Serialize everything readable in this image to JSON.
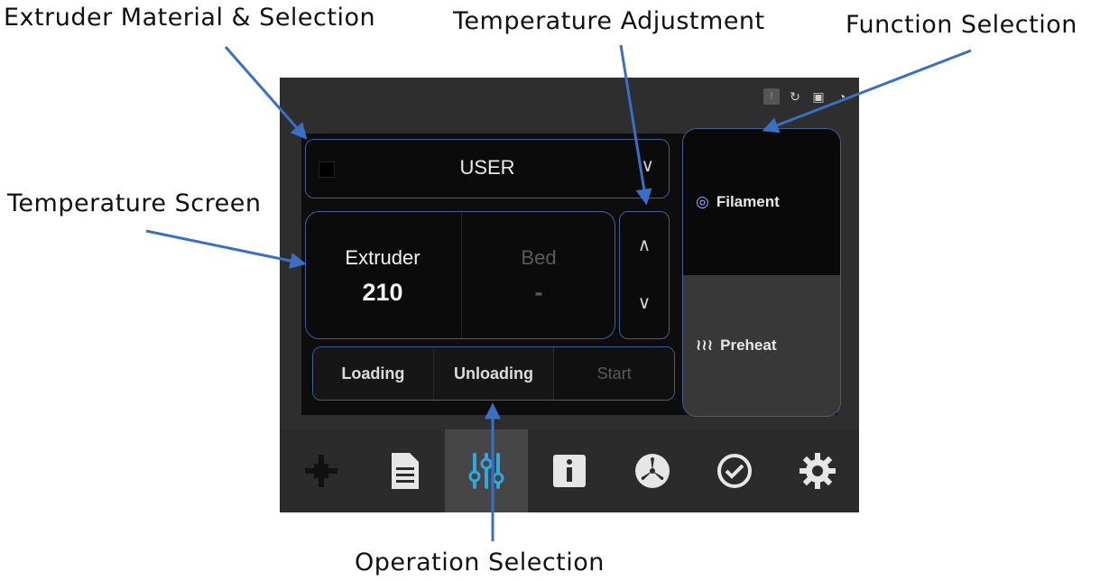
{
  "annotations": {
    "material": "Extruder Material & Selection",
    "temp_adjust": "Temperature Adjustment",
    "function": "Function Selection",
    "temp_screen": "Temperature Screen",
    "operation": "Operation Selection"
  },
  "material_select": {
    "value": "USER",
    "chevron": "∨"
  },
  "temperature": {
    "extruder_label": "Extruder",
    "extruder_value": "210",
    "bed_label": "Bed",
    "bed_value": "-"
  },
  "adjust": {
    "up": "∧",
    "down": "∨"
  },
  "operations": {
    "loading": "Loading",
    "unloading": "Unloading",
    "start": "Start"
  },
  "functions": {
    "filament": "Filament",
    "filament_icon": "◎",
    "preheat": "Preheat",
    "preheat_icon": "≀≀≀"
  },
  "status": {
    "indicator": "!"
  },
  "tabs": [
    {
      "icon": "move-axis-icon",
      "active": false
    },
    {
      "icon": "document-icon",
      "active": false
    },
    {
      "icon": "sliders-icon",
      "active": true
    },
    {
      "icon": "info-icon",
      "active": false
    },
    {
      "icon": "fan-icon",
      "active": false
    },
    {
      "icon": "check-circle-icon",
      "active": false
    },
    {
      "icon": "gear-icon",
      "active": false
    }
  ],
  "colors": {
    "accent": "#3f5f99",
    "arrow": "#3b6fc4",
    "active_tab_icon": "#2fa8e0"
  }
}
